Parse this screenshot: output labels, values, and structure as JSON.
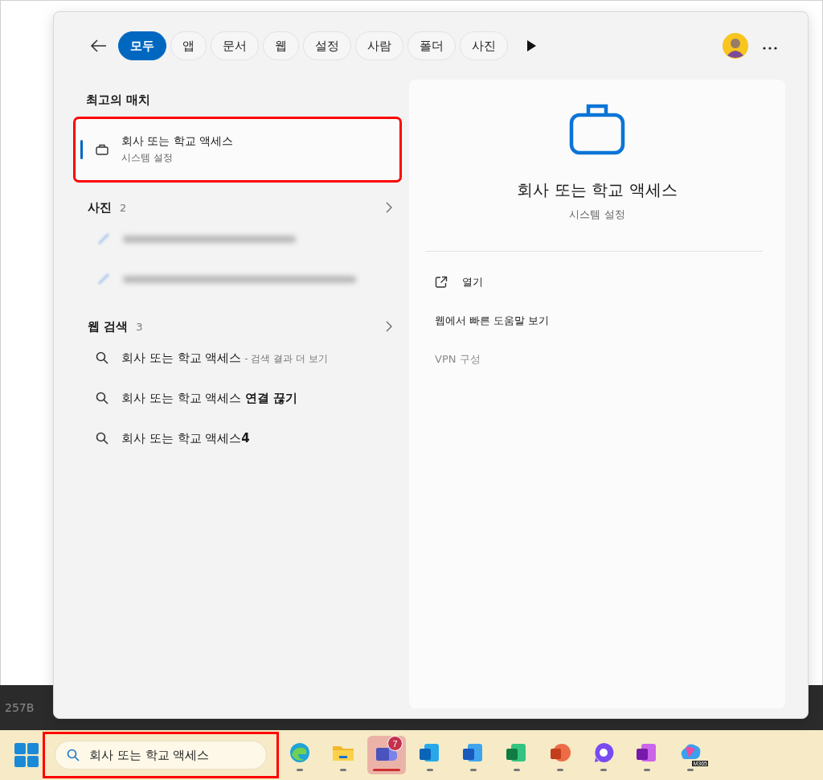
{
  "flyout": {
    "filters": [
      {
        "label": "모두",
        "selected": true
      },
      {
        "label": "앱",
        "selected": false
      },
      {
        "label": "문서",
        "selected": false
      },
      {
        "label": "웹",
        "selected": false
      },
      {
        "label": "설정",
        "selected": false
      },
      {
        "label": "사람",
        "selected": false
      },
      {
        "label": "폴더",
        "selected": false
      },
      {
        "label": "사진",
        "selected": false
      }
    ],
    "best_match": {
      "heading": "최고의 매치",
      "title": "회사 또는 학교 액세스",
      "subtitle": "시스템 설정",
      "selected": true,
      "highlighted": true
    },
    "photos": {
      "heading": "사진",
      "count": "2",
      "rows": [
        {
          "kind": "blurred"
        },
        {
          "kind": "blurred"
        }
      ]
    },
    "web_search": {
      "heading": "웹 검색",
      "count": "3",
      "items": [
        {
          "text": "회사 또는 학교 액세스",
          "suffix": "- 검색 결과 더 보기"
        },
        {
          "text": "회사 또는 학교 액세스 **연결 끊기**"
        },
        {
          "text": "회사 또는 학교 액세스**4**"
        }
      ]
    },
    "detail": {
      "title": "회사 또는 학교 액세스",
      "subtitle": "시스템 설정",
      "actions": [
        {
          "kind": "open",
          "label": "열기",
          "disabled": false
        },
        {
          "kind": "plain",
          "label": "웹에서 빠른 도움말 보기",
          "disabled": false
        },
        {
          "kind": "plain",
          "label": "VPN 구성",
          "disabled": true
        }
      ]
    }
  },
  "strip": {
    "text": "257B"
  },
  "taskbar": {
    "search_box": {
      "value": "회사 또는 학교 액세스",
      "highlighted": true
    },
    "apps": [
      {
        "kind": "edge",
        "selected": false
      },
      {
        "kind": "folder",
        "selected": false
      },
      {
        "kind": "teams",
        "selected": true,
        "badge": "7"
      },
      {
        "kind": "outlook",
        "selected": false
      },
      {
        "kind": "word",
        "selected": false
      },
      {
        "kind": "excel",
        "selected": false
      },
      {
        "kind": "powerpoint",
        "selected": false
      },
      {
        "kind": "chat",
        "selected": false
      },
      {
        "kind": "onenote",
        "selected": false
      },
      {
        "kind": "m365",
        "selected": false,
        "label": "M365"
      }
    ]
  }
}
